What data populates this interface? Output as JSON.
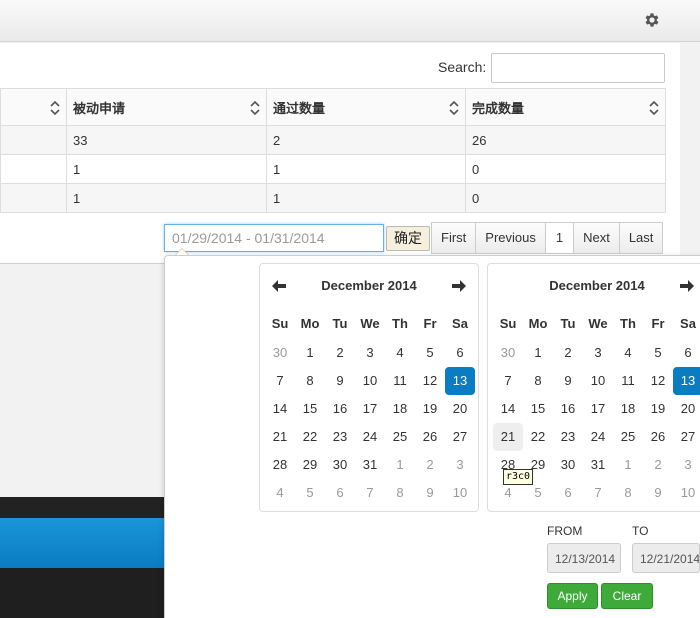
{
  "toolbar": {
    "settings_icon": "gear-icon"
  },
  "table": {
    "search_label": "Search:",
    "search_value": "",
    "columns": [
      "",
      "被动申请",
      "通过数量",
      "完成数量"
    ],
    "rows": [
      [
        "",
        "33",
        "2",
        "26"
      ],
      [
        "",
        "1",
        "1",
        "0"
      ],
      [
        "",
        "1",
        "1",
        "0"
      ]
    ]
  },
  "filter": {
    "date_range_value": "01/29/2014 - 01/31/2014",
    "confirm_label": "确定"
  },
  "pagination": {
    "first": "First",
    "previous": "Previous",
    "current": "1",
    "next": "Next",
    "last": "Last"
  },
  "datepicker": {
    "weekdays": [
      "Su",
      "Mo",
      "Tu",
      "We",
      "Th",
      "Fr",
      "Sa"
    ],
    "left_calendar": {
      "month": "December 2014",
      "weeks": [
        [
          "30",
          "1",
          "2",
          "3",
          "4",
          "5",
          "6"
        ],
        [
          "7",
          "8",
          "9",
          "10",
          "11",
          "12",
          "13"
        ],
        [
          "14",
          "15",
          "16",
          "17",
          "18",
          "19",
          "20"
        ],
        [
          "21",
          "22",
          "23",
          "24",
          "25",
          "26",
          "27"
        ],
        [
          "28",
          "29",
          "30",
          "31",
          "1",
          "2",
          "3"
        ],
        [
          "4",
          "5",
          "6",
          "7",
          "8",
          "9",
          "10"
        ]
      ],
      "selected": "13"
    },
    "right_calendar": {
      "month": "December 2014",
      "weeks": [
        [
          "30",
          "1",
          "2",
          "3",
          "4",
          "5",
          "6"
        ],
        [
          "7",
          "8",
          "9",
          "10",
          "11",
          "12",
          "13"
        ],
        [
          "14",
          "15",
          "16",
          "17",
          "18",
          "19",
          "20"
        ],
        [
          "21",
          "22",
          "23",
          "24",
          "25",
          "26",
          "27"
        ],
        [
          "28",
          "29",
          "30",
          "31",
          "1",
          "2",
          "3"
        ],
        [
          "4",
          "5",
          "6",
          "7",
          "8",
          "9",
          "10"
        ]
      ],
      "selected": "13",
      "hovered": "21"
    },
    "tooltip": "r3c0",
    "from_label": "FROM",
    "to_label": "TO",
    "from_value": "12/13/2014",
    "to_value": "12/21/2014",
    "apply_label": "Apply",
    "clear_label": "Clear"
  },
  "colors": {
    "accent_blue": "#0a7cc2",
    "apply_green": "#3eaa3a",
    "footer_blue": "#1b95d8"
  }
}
